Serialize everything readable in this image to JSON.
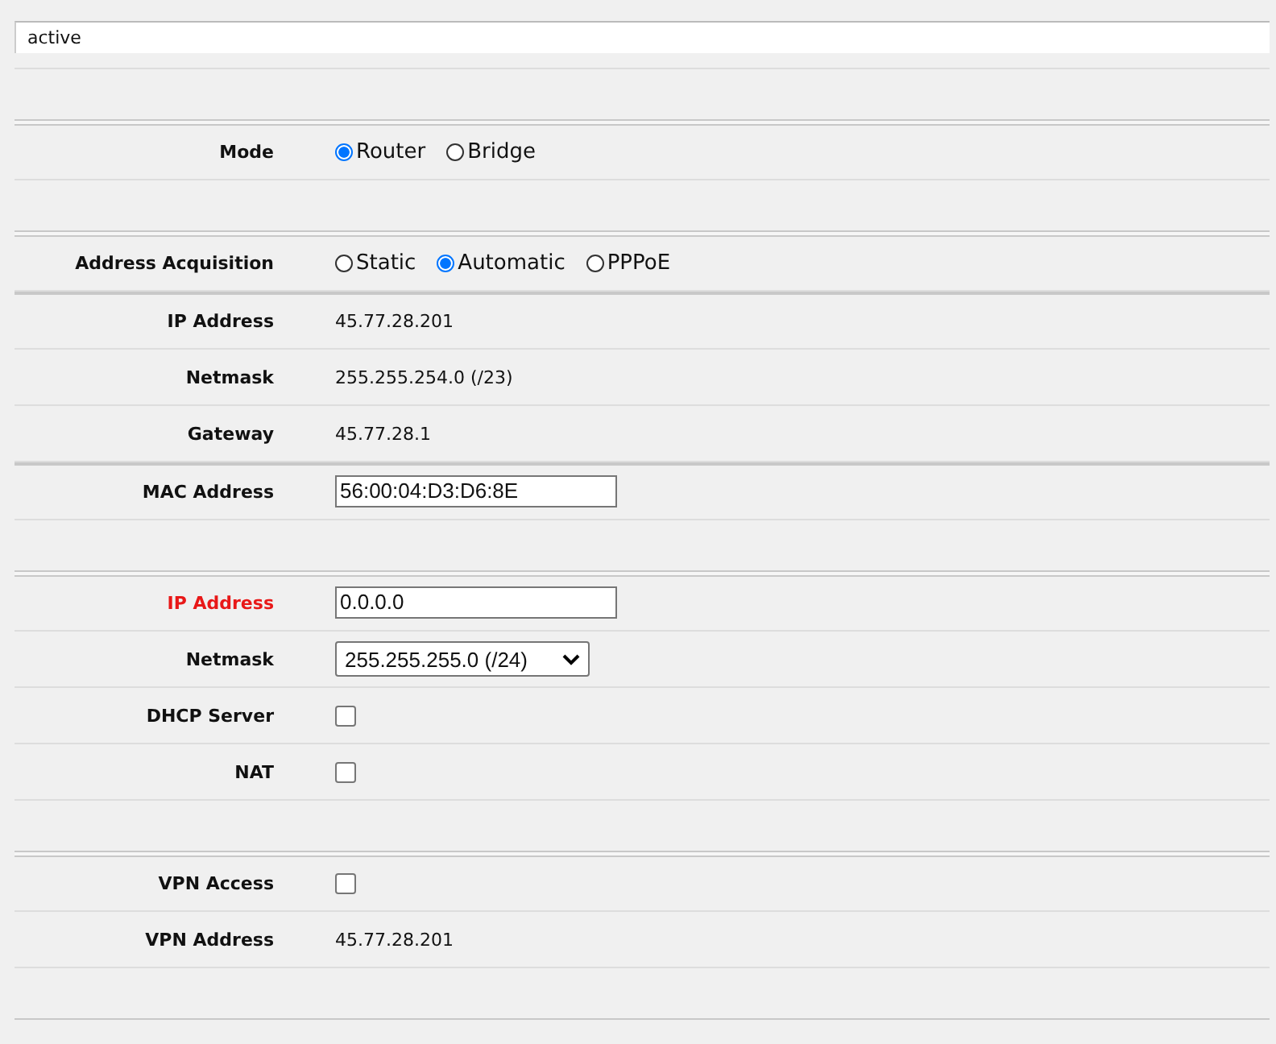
{
  "status": "active",
  "sections": [
    {
      "groups": [
        [
          {
            "kind": "radio",
            "label": "Mode",
            "options": [
              {
                "label": "Router",
                "selected": true
              },
              {
                "label": "Bridge",
                "selected": false
              }
            ]
          }
        ]
      ]
    },
    {
      "groups": [
        [
          {
            "kind": "radio",
            "label": "Address Acquisition",
            "options": [
              {
                "label": "Static",
                "selected": false
              },
              {
                "label": "Automatic",
                "selected": true
              },
              {
                "label": "PPPoE",
                "selected": false
              }
            ]
          }
        ],
        [
          {
            "kind": "text",
            "label": "IP Address",
            "value": "45.77.28.201"
          },
          {
            "kind": "text",
            "label": "Netmask",
            "value": "255.255.254.0 (/23)"
          },
          {
            "kind": "text",
            "label": "Gateway",
            "value": "45.77.28.1"
          }
        ],
        [
          {
            "kind": "input",
            "label": "MAC Address",
            "value": "56:00:04:D3:D6:8E",
            "invalid": false
          }
        ]
      ]
    },
    {
      "groups": [
        [
          {
            "kind": "input",
            "label": "IP Address",
            "value": "0.0.0.0",
            "invalid": true
          },
          {
            "kind": "select",
            "label": "Netmask",
            "value": "255.255.255.0 (/24)"
          },
          {
            "kind": "checkbox",
            "label": "DHCP Server",
            "checked": false
          },
          {
            "kind": "checkbox",
            "label": "NAT",
            "checked": false
          }
        ]
      ]
    },
    {
      "groups": [
        [
          {
            "kind": "checkbox",
            "label": "VPN Access",
            "checked": false
          },
          {
            "kind": "text",
            "label": "VPN Address",
            "value": "45.77.28.201"
          }
        ]
      ]
    }
  ]
}
